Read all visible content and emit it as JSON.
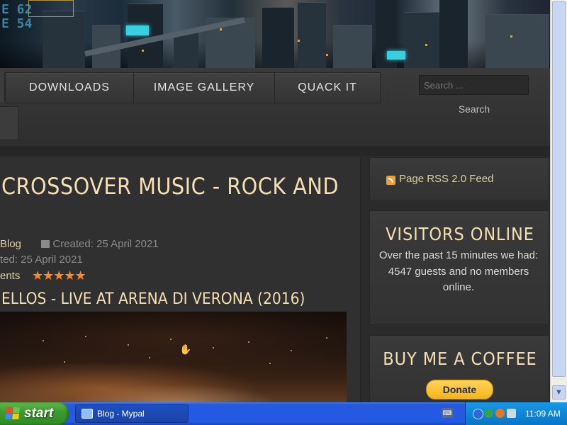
{
  "banner": {
    "hud_line1": "E 62",
    "hud_line2": "E 54"
  },
  "nav": {
    "items": [
      {
        "label": "DOWNLOADS"
      },
      {
        "label": "IMAGE GALLERY"
      },
      {
        "label": "QUACK IT"
      }
    ],
    "search_placeholder": "Search ...",
    "search_button": "Search"
  },
  "article": {
    "title": "CROSSOVER MUSIC - ROCK AND",
    "category": "Blog",
    "created": "Created: 25 April 2021",
    "updated": "ted: 25 April 2021",
    "comments": "ents",
    "stars": "★★★★★",
    "rating": 5,
    "subtitle": "ELLOS - LIVE AT ARENA DI VERONA (2016)"
  },
  "sidebar": {
    "rss_label": "Page RSS 2.0 Feed",
    "visitors_title": "VISITORS ONLINE",
    "visitors_text": "Over the past 15 minutes we had: 4547 guests and no members online.",
    "coffee_title": "BUY ME A COFFEE",
    "donate_label": "Donate"
  },
  "taskbar": {
    "start_label": "start",
    "window_label": "Blog - Mypal",
    "clock": "11:09 AM"
  },
  "colors": {
    "accent_text": "#f3dfb2",
    "star": "#ff8a1e",
    "taskbar": "#245ae2",
    "start_green": "#3a9a2c"
  }
}
